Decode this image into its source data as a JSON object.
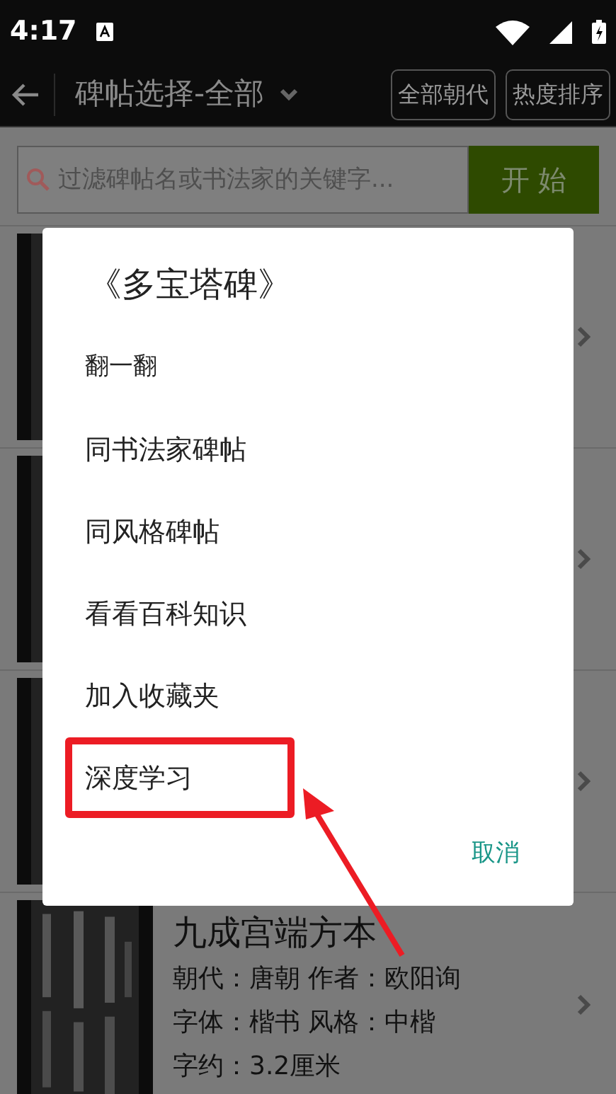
{
  "status_bar": {
    "time": "4:17"
  },
  "app_bar": {
    "title": "碑帖选择-全部",
    "buttons": [
      "全部朝代",
      "热度排序"
    ]
  },
  "search": {
    "placeholder": "过滤碑帖名或书法家的关键字...",
    "button": "开 始"
  },
  "rows": [
    {
      "kind": "covered"
    },
    {
      "kind": "covered"
    },
    {
      "kind": "covered"
    },
    {
      "kind": "entry",
      "title": "九成宫端方本",
      "lines": [
        "朝代：唐朝 作者：欧阳询",
        "字体：楷书 风格：中楷",
        "字约：3.2厘米"
      ]
    }
  ],
  "dialog": {
    "title": "《多宝塔碑》",
    "items": [
      {
        "label": "翻一翻",
        "highlighted": false
      },
      {
        "label": "同书法家碑帖",
        "highlighted": false
      },
      {
        "label": "同风格碑帖",
        "highlighted": false
      },
      {
        "label": "看看百科知识",
        "highlighted": false
      },
      {
        "label": "加入收藏夹",
        "highlighted": false
      },
      {
        "label": "深度学习",
        "highlighted": true
      }
    ],
    "cancel": "取消"
  }
}
